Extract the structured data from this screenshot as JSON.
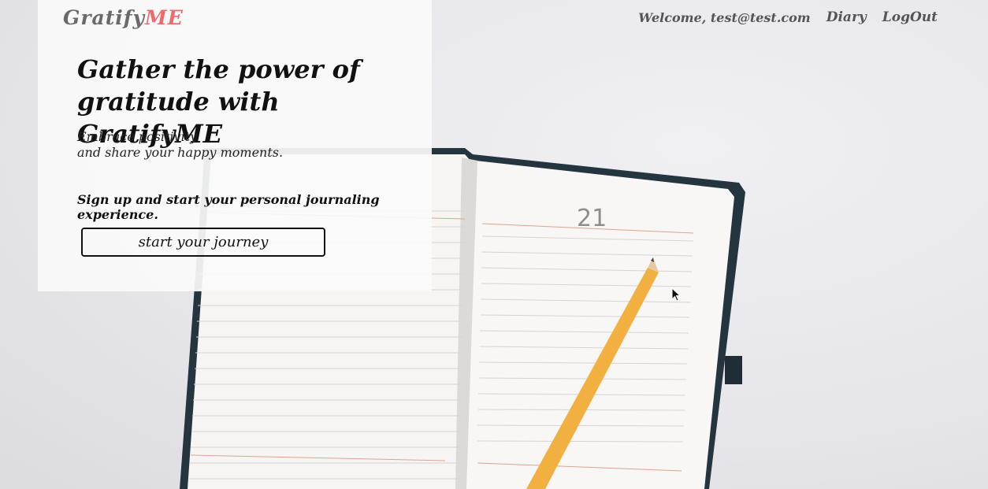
{
  "brand": {
    "prefix": "Gratify",
    "accent": "ME",
    "accent_color": "#f06a6a"
  },
  "nav": {
    "welcome": "Welcome, test@test.com",
    "diary": "Diary",
    "logout": "LogOut"
  },
  "hero": {
    "headline": "Gather the power of gratitude with GratifyME",
    "sub_line1": "Embrace positivity",
    "sub_line2": "and share your happy moments.",
    "signup": "Sign up and start your personal journaling experience.",
    "cta": "start your journey"
  },
  "notebook": {
    "page_number": "21"
  },
  "icons": [
    "mouse-cursor-icon"
  ]
}
